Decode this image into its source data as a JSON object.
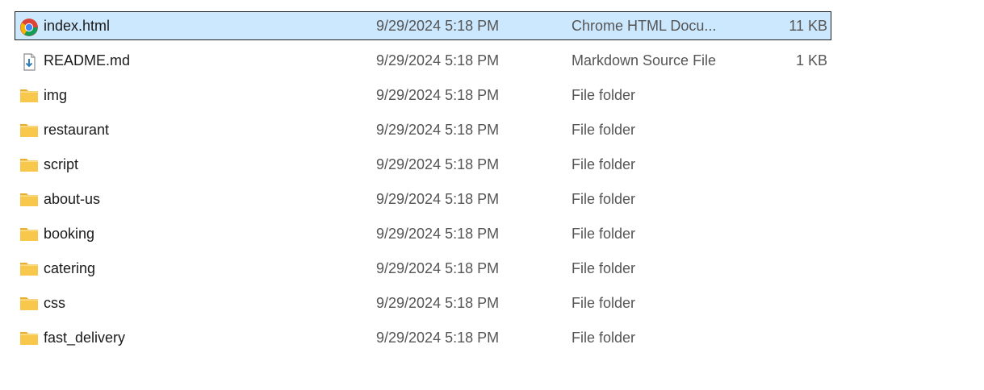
{
  "files": [
    {
      "name": "index.html",
      "date": "9/29/2024 5:18 PM",
      "type": "Chrome HTML Docu...",
      "size": "11 KB",
      "icon": "chrome-icon",
      "selected": true
    },
    {
      "name": "README.md",
      "date": "9/29/2024 5:18 PM",
      "type": "Markdown Source File",
      "size": "1 KB",
      "icon": "markdown-file-icon",
      "selected": false
    },
    {
      "name": "img",
      "date": "9/29/2024 5:18 PM",
      "type": "File folder",
      "size": "",
      "icon": "folder-icon",
      "selected": false
    },
    {
      "name": "restaurant",
      "date": "9/29/2024 5:18 PM",
      "type": "File folder",
      "size": "",
      "icon": "folder-icon",
      "selected": false
    },
    {
      "name": "script",
      "date": "9/29/2024 5:18 PM",
      "type": "File folder",
      "size": "",
      "icon": "folder-icon",
      "selected": false
    },
    {
      "name": "about-us",
      "date": "9/29/2024 5:18 PM",
      "type": "File folder",
      "size": "",
      "icon": "folder-icon",
      "selected": false
    },
    {
      "name": "booking",
      "date": "9/29/2024 5:18 PM",
      "type": "File folder",
      "size": "",
      "icon": "folder-icon",
      "selected": false
    },
    {
      "name": "catering",
      "date": "9/29/2024 5:18 PM",
      "type": "File folder",
      "size": "",
      "icon": "folder-icon",
      "selected": false
    },
    {
      "name": "css",
      "date": "9/29/2024 5:18 PM",
      "type": "File folder",
      "size": "",
      "icon": "folder-icon",
      "selected": false
    },
    {
      "name": "fast_delivery",
      "date": "9/29/2024 5:18 PM",
      "type": "File folder",
      "size": "",
      "icon": "folder-icon",
      "selected": false
    }
  ],
  "colors": {
    "selection_bg": "#cce8ff",
    "selection_border": "#1f1f1f",
    "folder_yellow": "#f8c84c",
    "text_secondary": "#555555"
  }
}
